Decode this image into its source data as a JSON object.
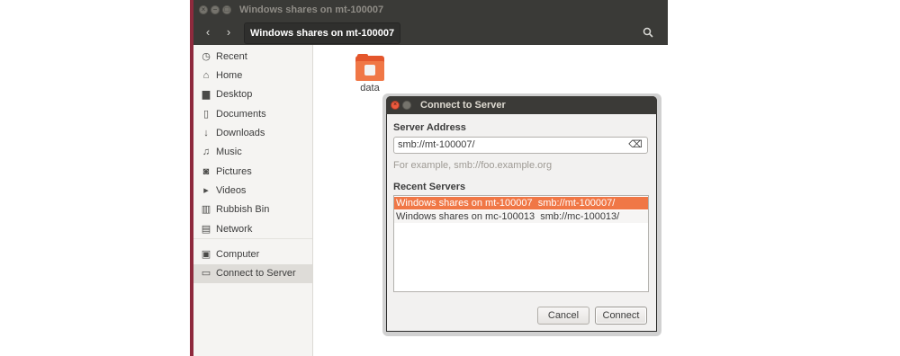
{
  "window": {
    "title": "Windows shares on mt-100007",
    "path_button": "Windows shares on mt-100007",
    "controls": {
      "close": "×",
      "minimize": "−",
      "maximize": "□"
    },
    "nav": {
      "back_icon": "‹",
      "forward_icon": "›",
      "search_icon": "⌕"
    }
  },
  "sidebar": {
    "items": [
      {
        "label": "Recent",
        "icon": "clock-icon",
        "glyph": "◷"
      },
      {
        "label": "Home",
        "icon": "home-icon",
        "glyph": "⌂"
      },
      {
        "label": "Desktop",
        "icon": "desktop-folder-icon",
        "glyph": "▆"
      },
      {
        "label": "Documents",
        "icon": "document-icon",
        "glyph": "▯"
      },
      {
        "label": "Downloads",
        "icon": "download-icon",
        "glyph": "↓"
      },
      {
        "label": "Music",
        "icon": "music-icon",
        "glyph": "♫"
      },
      {
        "label": "Pictures",
        "icon": "camera-icon",
        "glyph": "◙"
      },
      {
        "label": "Videos",
        "icon": "video-icon",
        "glyph": "▸"
      },
      {
        "label": "Rubbish Bin",
        "icon": "trash-icon",
        "glyph": "▥"
      },
      {
        "label": "Network",
        "icon": "network-icon",
        "glyph": "▤"
      },
      {
        "label": "Computer",
        "icon": "computer-icon",
        "glyph": "▣"
      },
      {
        "label": "Connect to Server",
        "icon": "server-icon",
        "glyph": "▭"
      }
    ],
    "active": "Connect to Server"
  },
  "content": {
    "folder": {
      "label": "data",
      "icon": "network-share-folder-icon"
    }
  },
  "dialog": {
    "title": "Connect to Server",
    "server_address_label": "Server Address",
    "server_address_value": "smb://mt-100007/",
    "clear_icon": "⌫",
    "hint": "For example, smb://foo.example.org",
    "recent_label": "Recent Servers",
    "recent_servers": [
      {
        "name": "Windows shares on mt-100007",
        "address": "smb://mt-100007/",
        "text": "Windows shares on mt-100007  smb://mt-100007/",
        "selected": true
      },
      {
        "name": "Windows shares on mc-100013",
        "address": "smb://mc-100013/",
        "text": "Windows shares on mc-100013  smb://mc-100013/",
        "selected": false
      }
    ],
    "cancel_label": "Cancel",
    "connect_label": "Connect"
  },
  "colors": {
    "accent": "#f07746",
    "titlebar": "#3a3a37",
    "left_accent": "#8e2a3d"
  }
}
